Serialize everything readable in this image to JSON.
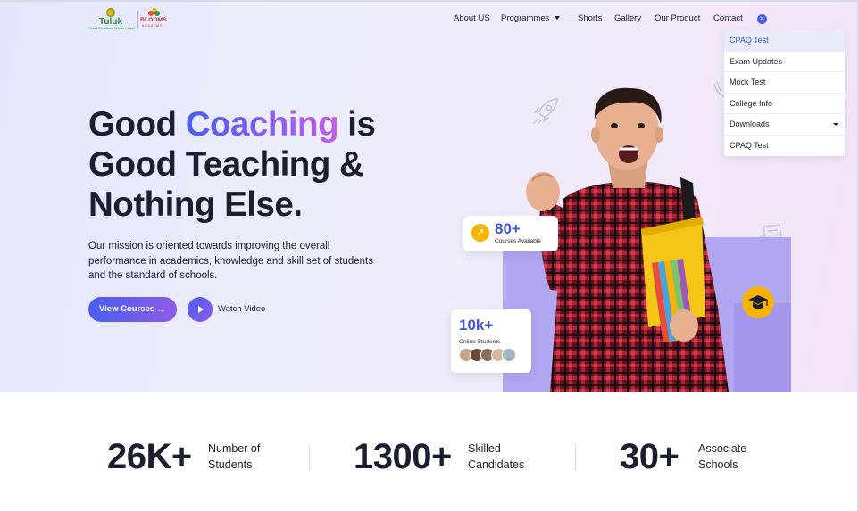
{
  "brand": {
    "logo1_name": "Tuluk",
    "logo1_tagline": "Gunni Excellence Private Limited",
    "logo2_name": "BLOOMS",
    "logo2_tagline": "ACADEMY"
  },
  "nav": {
    "items": [
      "About US",
      "Programmes",
      "Shorts",
      "Gallery",
      "Our Product",
      "Contact"
    ],
    "close_icon": "close-icon"
  },
  "dropdown": {
    "items": [
      "CPAQ Test",
      "Exam Updates",
      "Mock Test",
      "College Info",
      "Downloads",
      "CPAQ Test"
    ],
    "active_index": 0
  },
  "hero": {
    "line1_start": "Good ",
    "line1_highlight": "Coaching",
    "line1_end": " is",
    "line2": "Good Teaching &",
    "line3": "Nothing Else.",
    "mission": "Our mission is oriented towards improving the overall performance in academics, knowledge and skill set of students and the standard of schools.",
    "primary_button": "View Courses",
    "secondary_button": "Watch Video"
  },
  "cards": {
    "courses": {
      "value": "80+",
      "label": "Courses Available"
    },
    "students": {
      "value": "10k+",
      "label": "Online Students"
    }
  },
  "stats": [
    {
      "value": "26K+",
      "line1": "Number of",
      "line2": "Students"
    },
    {
      "value": "1300+",
      "line1": "Skilled",
      "line2": "Candidates"
    },
    {
      "value": "30+",
      "line1": "Associate",
      "line2": "Schools"
    }
  ],
  "colors": {
    "accent": "#4660ec",
    "gradient_end": "#c25ee6",
    "badge_yellow": "#f4b400",
    "purple_block": "#b1a6f0"
  }
}
